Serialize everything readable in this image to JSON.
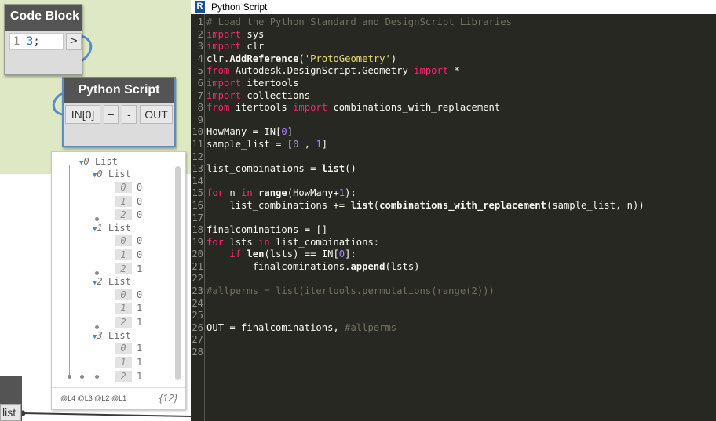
{
  "canvas": {
    "code_block": {
      "title": "Code Block",
      "line_number": "1",
      "code_number": "3",
      "code_rest": ";",
      "output_port": ">"
    },
    "python_node": {
      "title": "Python Script",
      "input_port": "IN[0]",
      "add_input": "+",
      "remove_input": "-",
      "output_port": "OUT"
    },
    "preview": {
      "root": {
        "index": "0",
        "label": "List"
      },
      "groups": [
        {
          "index": "0",
          "label": "List",
          "items": [
            {
              "i": "0",
              "v": "0"
            },
            {
              "i": "1",
              "v": "0"
            },
            {
              "i": "2",
              "v": "0"
            }
          ]
        },
        {
          "index": "1",
          "label": "List",
          "items": [
            {
              "i": "0",
              "v": "0"
            },
            {
              "i": "1",
              "v": "0"
            },
            {
              "i": "2",
              "v": "1"
            }
          ]
        },
        {
          "index": "2",
          "label": "List",
          "items": [
            {
              "i": "0",
              "v": "0"
            },
            {
              "i": "1",
              "v": "1"
            },
            {
              "i": "2",
              "v": "1"
            }
          ]
        },
        {
          "index": "3",
          "label": "List",
          "items": [
            {
              "i": "0",
              "v": "1"
            },
            {
              "i": "1",
              "v": "1"
            },
            {
              "i": "2",
              "v": "1"
            }
          ]
        }
      ],
      "levels": "@L4 @L3 @L2 @L1",
      "count": "{12}"
    },
    "list_node_port": "list"
  },
  "editor": {
    "window_title": "Python Script",
    "app_icon": "R",
    "lines": [
      {
        "n": "1",
        "tokens": [
          {
            "t": "# Load the Python Standard and DesignScript Libraries",
            "c": "cm"
          }
        ]
      },
      {
        "n": "2",
        "tokens": [
          {
            "t": "import",
            "c": "kw"
          },
          {
            "t": " sys",
            "c": ""
          }
        ]
      },
      {
        "n": "3",
        "tokens": [
          {
            "t": "import",
            "c": "kw"
          },
          {
            "t": " clr",
            "c": ""
          }
        ]
      },
      {
        "n": "4",
        "tokens": [
          {
            "t": "clr.",
            "c": ""
          },
          {
            "t": "AddReference",
            "c": "b"
          },
          {
            "t": "(",
            "c": ""
          },
          {
            "t": "'ProtoGeometry'",
            "c": "str"
          },
          {
            "t": ")",
            "c": ""
          }
        ]
      },
      {
        "n": "5",
        "tokens": [
          {
            "t": "from",
            "c": "kw"
          },
          {
            "t": " Autodesk.DesignScript.Geometry ",
            "c": ""
          },
          {
            "t": "import",
            "c": "kw"
          },
          {
            "t": " *",
            "c": ""
          }
        ]
      },
      {
        "n": "6",
        "tokens": [
          {
            "t": "import",
            "c": "kw"
          },
          {
            "t": " itertools",
            "c": ""
          }
        ]
      },
      {
        "n": "7",
        "tokens": [
          {
            "t": "import",
            "c": "kw"
          },
          {
            "t": " collections",
            "c": ""
          }
        ]
      },
      {
        "n": "8",
        "tokens": [
          {
            "t": "from",
            "c": "kw"
          },
          {
            "t": " itertools ",
            "c": ""
          },
          {
            "t": "import",
            "c": "kw"
          },
          {
            "t": " combinations_with_replacement",
            "c": ""
          }
        ]
      },
      {
        "n": "9",
        "tokens": []
      },
      {
        "n": "10",
        "tokens": [
          {
            "t": "HowMany = IN[",
            "c": ""
          },
          {
            "t": "0",
            "c": "num"
          },
          {
            "t": "]",
            "c": ""
          }
        ]
      },
      {
        "n": "11",
        "tokens": [
          {
            "t": "sample_list = [",
            "c": ""
          },
          {
            "t": "0",
            "c": "num"
          },
          {
            "t": " , ",
            "c": ""
          },
          {
            "t": "1",
            "c": "num"
          },
          {
            "t": "]",
            "c": ""
          }
        ]
      },
      {
        "n": "12",
        "tokens": []
      },
      {
        "n": "13",
        "tokens": [
          {
            "t": "list_combinations = ",
            "c": ""
          },
          {
            "t": "list",
            "c": "b"
          },
          {
            "t": "()",
            "c": ""
          }
        ]
      },
      {
        "n": "14",
        "tokens": []
      },
      {
        "n": "15",
        "tokens": [
          {
            "t": "for",
            "c": "kw"
          },
          {
            "t": " n ",
            "c": ""
          },
          {
            "t": "in",
            "c": "kw"
          },
          {
            "t": " ",
            "c": ""
          },
          {
            "t": "range",
            "c": "b"
          },
          {
            "t": "(HowMany+",
            "c": ""
          },
          {
            "t": "1",
            "c": "num"
          },
          {
            "t": "):",
            "c": ""
          }
        ]
      },
      {
        "n": "16",
        "tokens": [
          {
            "t": "    list_combinations += ",
            "c": ""
          },
          {
            "t": "list",
            "c": "b"
          },
          {
            "t": "(",
            "c": ""
          },
          {
            "t": "combinations_with_replacement",
            "c": "b"
          },
          {
            "t": "(sample_list, n))",
            "c": ""
          }
        ]
      },
      {
        "n": "17",
        "tokens": []
      },
      {
        "n": "18",
        "tokens": [
          {
            "t": "finalcominations = []",
            "c": ""
          }
        ]
      },
      {
        "n": "19",
        "tokens": [
          {
            "t": "for",
            "c": "kw"
          },
          {
            "t": " lsts ",
            "c": ""
          },
          {
            "t": "in",
            "c": "kw"
          },
          {
            "t": " list_combinations:",
            "c": ""
          }
        ]
      },
      {
        "n": "20",
        "tokens": [
          {
            "t": "    ",
            "c": ""
          },
          {
            "t": "if",
            "c": "kw"
          },
          {
            "t": " ",
            "c": ""
          },
          {
            "t": "len",
            "c": "b"
          },
          {
            "t": "(lsts) == IN[",
            "c": ""
          },
          {
            "t": "0",
            "c": "num"
          },
          {
            "t": "]:",
            "c": ""
          }
        ]
      },
      {
        "n": "21",
        "tokens": [
          {
            "t": "        finalcominations.",
            "c": ""
          },
          {
            "t": "append",
            "c": "b"
          },
          {
            "t": "(lsts)",
            "c": ""
          }
        ]
      },
      {
        "n": "22",
        "tokens": []
      },
      {
        "n": "23",
        "tokens": [
          {
            "t": "#allperms = list(itertools.permutations(range(2)))",
            "c": "cm"
          }
        ]
      },
      {
        "n": "24",
        "tokens": []
      },
      {
        "n": "25",
        "tokens": []
      },
      {
        "n": "26",
        "tokens": [
          {
            "t": "OUT = finalcominations, ",
            "c": ""
          },
          {
            "t": "#allperms",
            "c": "cm"
          }
        ]
      },
      {
        "n": "27",
        "tokens": []
      },
      {
        "n": "28",
        "tokens": []
      }
    ]
  }
}
